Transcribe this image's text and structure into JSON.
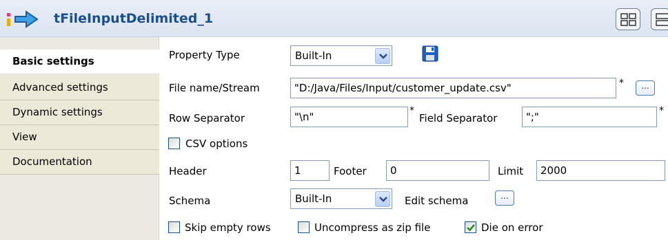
{
  "header": {
    "title": "tFileInputDelimited_1",
    "icon": "component-arrow-icon",
    "buttons": [
      "layout-grid-icon",
      "layout-list-icon"
    ]
  },
  "sidebar": {
    "items": [
      {
        "label": "Basic settings",
        "active": true
      },
      {
        "label": "Advanced settings",
        "active": false
      },
      {
        "label": "Dynamic settings",
        "active": false
      },
      {
        "label": "View",
        "active": false
      },
      {
        "label": "Documentation",
        "active": false
      }
    ]
  },
  "form": {
    "property_type": {
      "label": "Property Type",
      "value": "Built-In"
    },
    "file_name": {
      "label": "File name/Stream",
      "value": "\"D:/Java/Files/Input/customer_update.csv\""
    },
    "row_separator": {
      "label": "Row Separator",
      "value": "\"\\n\""
    },
    "field_separator": {
      "label": "Field Separator",
      "value": "\";\""
    },
    "required_marker": "*",
    "csv_options": {
      "label": "CSV options",
      "checked": false
    },
    "header": {
      "label": "Header",
      "value": "1"
    },
    "footer": {
      "label": "Footer",
      "value": "0"
    },
    "limit": {
      "label": "Limit",
      "value": "2000"
    },
    "schema": {
      "label": "Schema",
      "value": "Built-In"
    },
    "edit_schema": {
      "label": "Edit schema"
    },
    "ellipsis": "...",
    "skip_empty_rows": {
      "label": "Skip empty rows",
      "checked": false
    },
    "uncompress_zip": {
      "label": "Uncompress as zip file",
      "checked": false
    },
    "die_on_error": {
      "label": "Die on error",
      "checked": true
    }
  }
}
